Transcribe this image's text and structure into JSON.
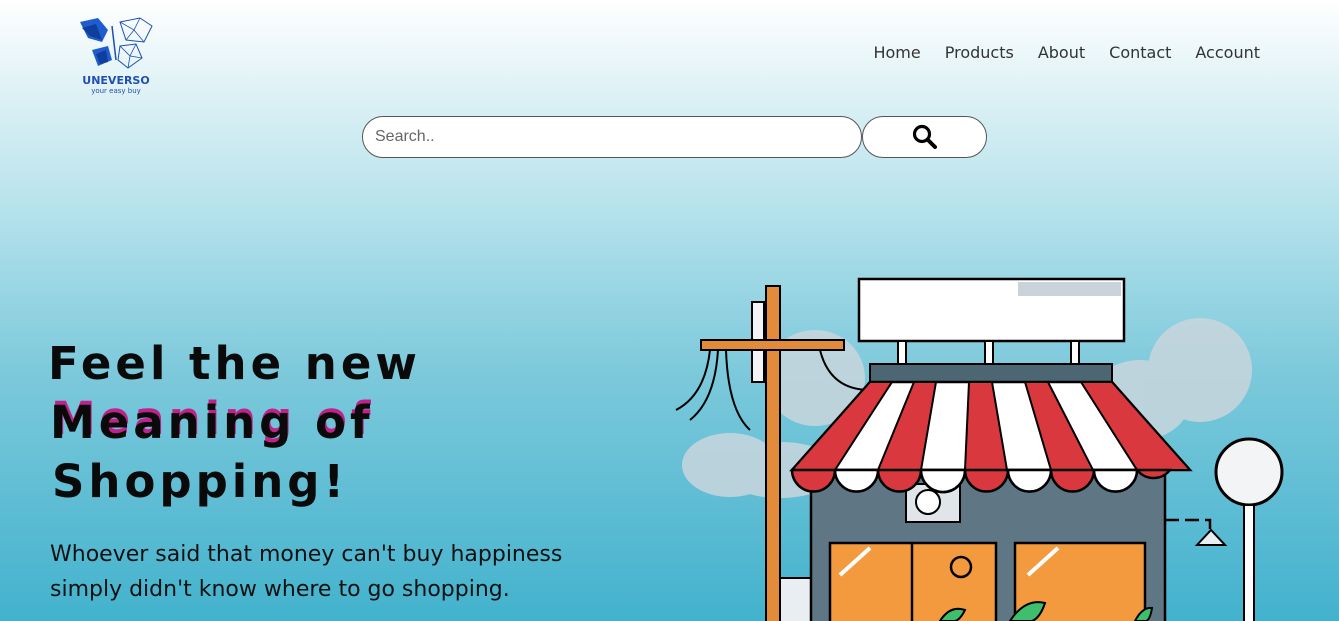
{
  "brand": {
    "name": "UNEVERSO",
    "tagline": "your easy buy"
  },
  "nav": {
    "items": [
      "Home",
      "Products",
      "About",
      "Contact",
      "Account"
    ]
  },
  "search": {
    "placeholder": "Search..",
    "value": "",
    "button_icon": "search-icon"
  },
  "hero": {
    "title_line1": "Feel the new",
    "title_line2": "Meaning of",
    "title_line3": "Shopping!",
    "subtitle_line1": "Whoever said that money can't buy happiness",
    "subtitle_line2": "simply didn't know where to go shopping."
  },
  "illustration": {
    "name": "storefront-illustration"
  },
  "colors": {
    "accent": "#1f4fb3",
    "title_shadow": "#c0218a",
    "awning_red": "#d9393e"
  }
}
